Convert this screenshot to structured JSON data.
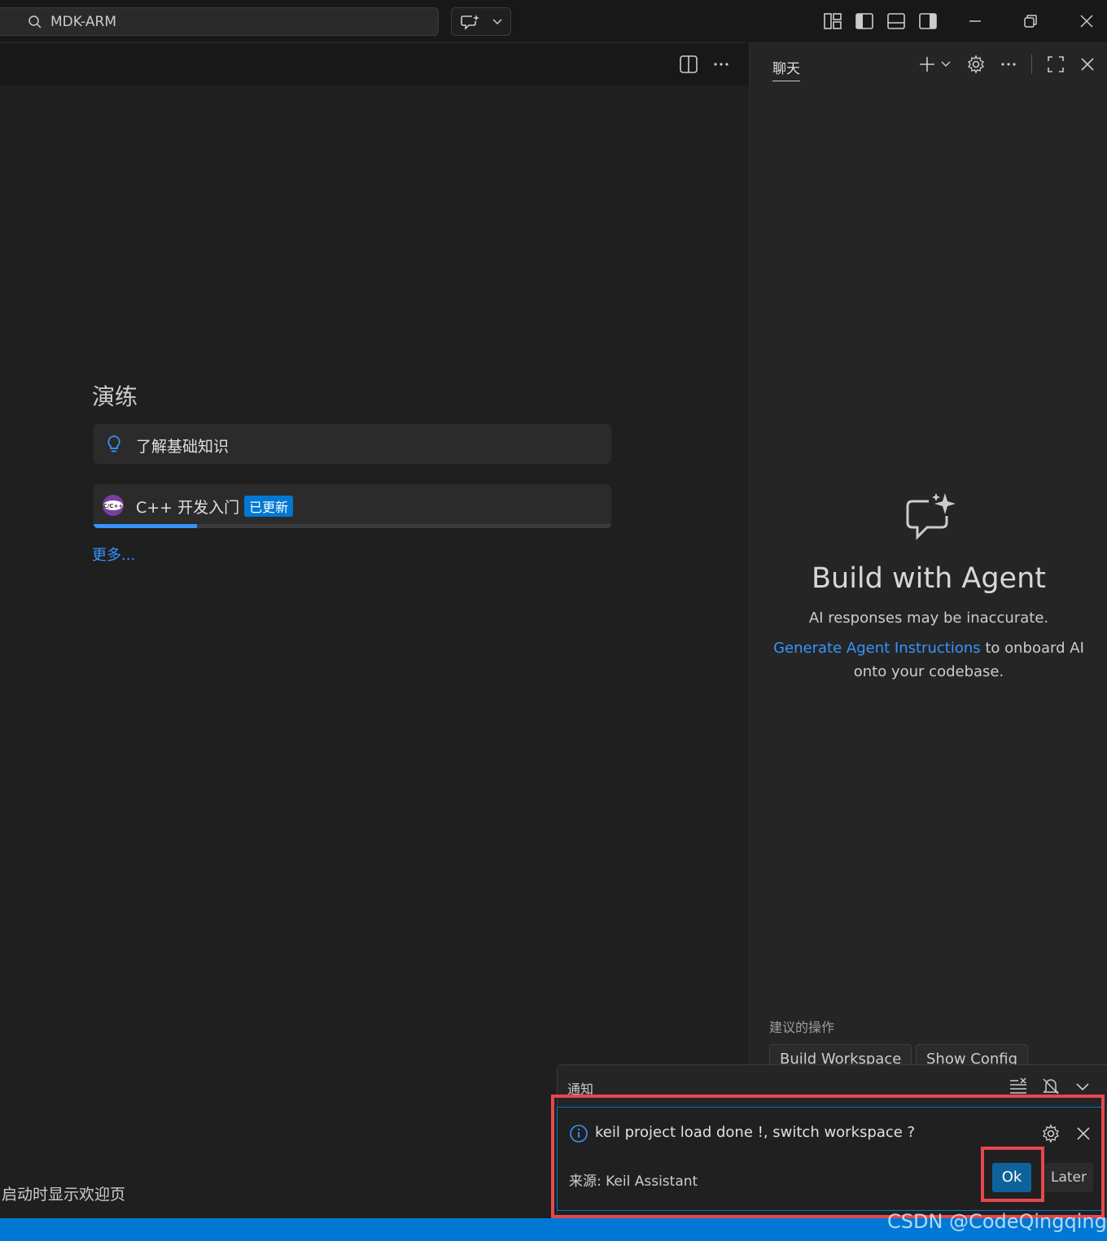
{
  "titlebar": {
    "search_text": "MDK-ARM",
    "icons": [
      "search-icon",
      "copilot-chat-icon",
      "chevron-down-icon",
      "customize-layout-icon",
      "toggle-primary-sidebar-icon",
      "toggle-panel-icon",
      "toggle-secondary-sidebar-icon",
      "minimize-icon",
      "restore-icon",
      "close-icon"
    ]
  },
  "editor": {
    "walkthrough_title": "演练",
    "items": [
      {
        "label": "了解基础知识",
        "icon": "lightbulb-icon"
      },
      {
        "label": "C++ 开发入门",
        "badge": "已更新",
        "icon": "cpp-icon",
        "progress": 0.2
      }
    ],
    "more_link": "更多...",
    "startup_label": "启动时显示欢迎页"
  },
  "chat": {
    "tab_label": "聊天",
    "title": "Build with Agent",
    "subtitle": "AI responses may be inaccurate.",
    "link_text": "Generate Agent Instructions",
    "line2_rest": " to onboard AI",
    "line3": "onto your codebase.",
    "suggested_title": "建议的操作",
    "suggested_actions": [
      "Build Workspace",
      "Show Config"
    ]
  },
  "notifications": {
    "header": "通知",
    "message": "keil project load done !, switch workspace ?",
    "source": "来源: Keil Assistant",
    "ok_label": "Ok",
    "later_label": "Later"
  },
  "watermark": "CSDN @CodeQingqing",
  "colors": {
    "accent": "#0078d4",
    "link": "#3794ff",
    "highlight": "#e5484d"
  }
}
